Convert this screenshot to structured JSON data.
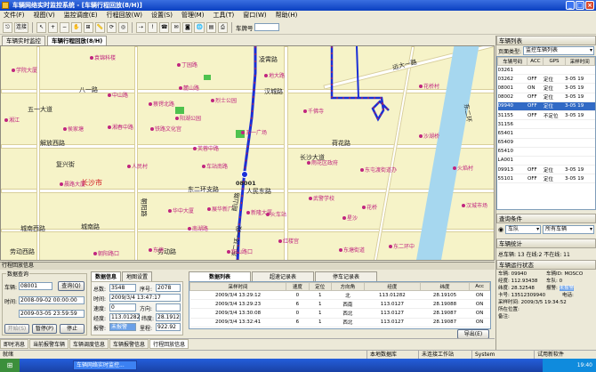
{
  "window": {
    "title": "车辆网络实时监控系统 - [车辆行程回放(8/H)]"
  },
  "menu": [
    "文件(F)",
    "视图(V)",
    "监控调度(E)",
    "行程回放(W)",
    "设置(S)",
    "管理(M)",
    "工具(T)",
    "窗口(W)",
    "帮助(H)"
  ],
  "toolbar": {
    "connect_label": "连接",
    "plate_label": "车牌号"
  },
  "doc_tabs": [
    "车辆实时监控",
    "车辆行程回放(8/H)"
  ],
  "map": {
    "roads": [
      "八一路",
      "五一大道",
      "解放西路",
      "复兴街",
      "城南西路",
      "城南路",
      "劳动西路",
      "东二环支路",
      "劳动路",
      "荷花路",
      "汉城路",
      "长沙市",
      "凌霄路",
      "远大一路",
      "东二环",
      "朝阳路",
      "人民东路",
      "韶山路",
      "东二环一段",
      "长沙大道"
    ],
    "pois": [
      "袁锦科楼",
      "学院大厦",
      "中山路",
      "五一广场",
      "蔡锷北路",
      "湘春中路",
      "铁路文化宫",
      "湘江",
      "阳湖公园",
      "人民村",
      "火车站",
      "新隆大厦",
      "车站南路",
      "东塘",
      "南湖路",
      "红楼宫",
      "武警学校",
      "星沙",
      "雨花区政府",
      "千佛寺",
      "火焰村",
      "东屯渡街道办",
      "汉城市场",
      "晨路大厦",
      "花桥村",
      "丁园路",
      "地大路",
      "华中大厦",
      "侯家塘",
      "麓山路",
      "花桥",
      "烈士公园",
      "展华新厂",
      "韶山路口",
      "朝阳路口",
      "东二环中",
      "东塘街道",
      "芙蓉中路",
      "沙湖桥"
    ],
    "vehicle_label": "08001"
  },
  "vehicle_list": {
    "title": "车辆列表",
    "filter_label": "页面类型:",
    "filter_value": "监控车辆列表",
    "columns": [
      "车辆号码",
      "ACC",
      "GPS",
      "采样时间"
    ],
    "rows": [
      {
        "id": "03261",
        "acc": "",
        "gps": "",
        "time": ""
      },
      {
        "id": "03262",
        "acc": "OFF",
        "gps": "定位",
        "time": "3-05 19"
      },
      {
        "id": "08001",
        "acc": "ON",
        "gps": "定位",
        "time": "3-05 19"
      },
      {
        "id": "08002",
        "acc": "OFF",
        "gps": "定位",
        "time": "3-05 19"
      },
      {
        "id": "09940",
        "acc": "OFF",
        "gps": "定位",
        "time": "3-05 19"
      },
      {
        "id": "31155",
        "acc": "OFF",
        "gps": "不定位",
        "time": "3-05 19"
      },
      {
        "id": "31156",
        "acc": "",
        "gps": "",
        "time": ""
      },
      {
        "id": "65401",
        "acc": "",
        "gps": "",
        "time": ""
      },
      {
        "id": "65409",
        "acc": "",
        "gps": "",
        "time": ""
      },
      {
        "id": "65410",
        "acc": "",
        "gps": "",
        "time": ""
      },
      {
        "id": "LA001",
        "acc": "",
        "gps": "",
        "time": ""
      },
      {
        "id": "09913",
        "acc": "OFF",
        "gps": "定位",
        "time": "3-05 19"
      },
      {
        "id": "55101",
        "acc": "OFF",
        "gps": "定位",
        "time": "3-05 19"
      }
    ],
    "selected_index": 4
  },
  "query": {
    "title": "查询条件",
    "team": "车队",
    "scope": "所有车辆"
  },
  "stats": {
    "title": "车辆统计",
    "text": "总车辆: 13 在线:2 不在线: 11"
  },
  "status_panel": {
    "title": "车辆运行状态",
    "plate_label": "车辆:",
    "plate": "09940",
    "vid_label": "车辆ID:",
    "vid": "MOSCO",
    "lng_label": "经度:",
    "lng": "112.93438",
    "team_label": "车队:",
    "team": "0",
    "lat_label": "纬度:",
    "lat": "28.32548",
    "alarm_label": "报警:",
    "alarm": "未报警",
    "phone_label": "卡号:",
    "phone": "13512309940",
    "tel_label": "电话:",
    "tel": "",
    "time_label": "采样时间:",
    "time": "2009/3/5 19:34:52",
    "pos_label": "所在位置:",
    "pos": "",
    "note_label": "备注:",
    "note": ""
  },
  "playback": {
    "panel_title": "行程回放信息",
    "query_group": "数据查询",
    "vehicle_label": "车辆:",
    "vehicle": "08001",
    "query_btn": "查询(Q)",
    "time_label": "时间:",
    "start": "2008-09-02 00:00:00",
    "end": "2009-03-05 23:59:59",
    "start_btn": "开始(S)",
    "pause_btn": "暂停(P)",
    "stop_btn": "停止",
    "tabs": [
      "数据信息",
      "地图设置"
    ],
    "total_label": "总数:",
    "total": "3548",
    "seq_label": "序号:",
    "seq": "2078",
    "time2_label": "时间:",
    "time2": "2009/3/4 13:47:17",
    "speed_label": "速度:",
    "speed": "0",
    "dir_label": "方向:",
    "dir": "",
    "lng_label": "经度:",
    "lng": "113.01282",
    "lat_label": "纬度:",
    "lat": "28.1912",
    "alarm_label": "报警:",
    "alarm": "未报警",
    "mile_label": "里程:",
    "mile": "922.92"
  },
  "data_list": {
    "tabs": [
      "数据列表",
      "超速记录表",
      "停车记录表"
    ],
    "columns": [
      "采样时间",
      "速度",
      "定位",
      "方向角",
      "经度",
      "纬度",
      "Acc"
    ],
    "rows": [
      [
        "2009/3/4 13:29:12",
        "0",
        "1",
        "北",
        "113.01282",
        "28.19105",
        "ON"
      ],
      [
        "2009/3/4 13:29:23",
        "6",
        "1",
        "西南",
        "113.0127",
        "28.19088",
        "ON"
      ],
      [
        "2009/3/4 13:30:08",
        "0",
        "1",
        "西北",
        "113.0127",
        "28.19087",
        "ON"
      ],
      [
        "2009/3/4 13:32:41",
        "6",
        "1",
        "西北",
        "113.0127",
        "28.19087",
        "ON"
      ],
      [
        "2009/3/4 13:33:13",
        "6",
        "1",
        "北",
        "113.01282",
        "28.19106",
        "ON"
      ]
    ],
    "export_btn": "导出(E)"
  },
  "bottom_tabs": [
    "即时消息",
    "当前报警车辆",
    "车辆调度信息",
    "车辆报警信息",
    "行程回放信息"
  ],
  "statusbar": {
    "left": "就绪",
    "db": "本地数据库",
    "conn": "未连接工作站",
    "sys": "System",
    "mode": "试用新软件"
  },
  "taskbar": {
    "task": "车辆网络实时监控...",
    "clock": "19:40"
  }
}
